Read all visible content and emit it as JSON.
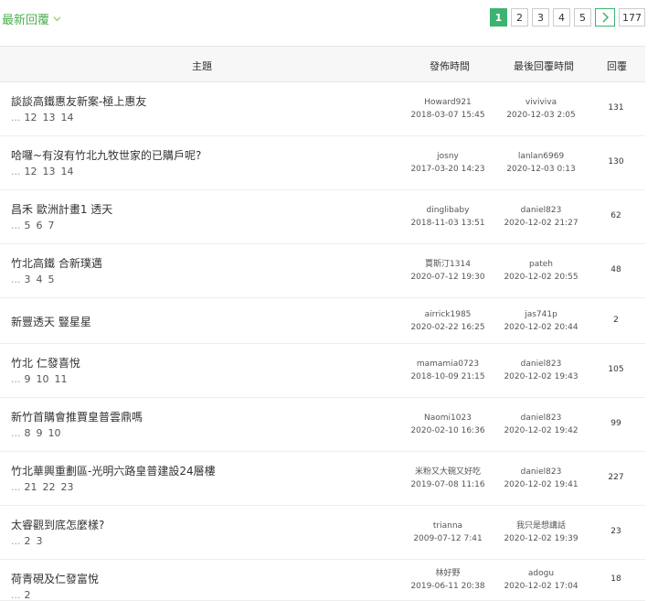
{
  "sort": {
    "label": "最新回覆"
  },
  "pager": {
    "pages": [
      "1",
      "2",
      "3",
      "4",
      "5"
    ],
    "last": "177",
    "active": "1"
  },
  "headers": {
    "topic": "主題",
    "posted": "發佈時間",
    "last_reply": "最後回覆時間",
    "replies": "回覆"
  },
  "rows": [
    {
      "title": "談談高鐵惠友新案-極上惠友",
      "pages": [
        "12",
        "13",
        "14"
      ],
      "author": "Howard921",
      "post_time": "2018-03-07 15:45",
      "last_user": "viviviva",
      "last_time": "2020-12-03 2:05",
      "replies": "131"
    },
    {
      "title": "哈囉~有沒有竹北九牧世家的已購戶呢?",
      "pages": [
        "12",
        "13",
        "14"
      ],
      "author": "josny",
      "post_time": "2017-03-20 14:23",
      "last_user": "lanlan6969",
      "last_time": "2020-12-03 0:13",
      "replies": "130"
    },
    {
      "title": "昌禾 歐洲計畫1 透天",
      "pages": [
        "5",
        "6",
        "7"
      ],
      "author": "dinglibaby",
      "post_time": "2018-11-03 13:51",
      "last_user": "daniel823",
      "last_time": "2020-12-02 21:27",
      "replies": "62"
    },
    {
      "title": "竹北高鐵 合新璞邁",
      "pages": [
        "3",
        "4",
        "5"
      ],
      "author": "賈斯汀1314",
      "post_time": "2020-07-12 19:30",
      "last_user": "pateh",
      "last_time": "2020-12-02 20:55",
      "replies": "48"
    },
    {
      "title": "新豐透天 豎星星",
      "pages": [],
      "author": "airrick1985",
      "post_time": "2020-02-22 16:25",
      "last_user": "jas741p",
      "last_time": "2020-12-02 20:44",
      "replies": "2"
    },
    {
      "title": "竹北 仁發喜悅",
      "pages": [
        "9",
        "10",
        "11"
      ],
      "author": "mamamia0723",
      "post_time": "2018-10-09 21:15",
      "last_user": "daniel823",
      "last_time": "2020-12-02 19:43",
      "replies": "105"
    },
    {
      "title": "新竹首購會推賈皇普雲鼎嗎",
      "pages": [
        "8",
        "9",
        "10"
      ],
      "author": "Naomi1023",
      "post_time": "2020-02-10 16:36",
      "last_user": "daniel823",
      "last_time": "2020-12-02 19:42",
      "replies": "99"
    },
    {
      "title": "竹北華興重劃區-光明六路皇普建設24層樓",
      "pages": [
        "21",
        "22",
        "23"
      ],
      "author": "米粉又大碗又好吃",
      "post_time": "2019-07-08 11:16",
      "last_user": "daniel823",
      "last_time": "2020-12-02 19:41",
      "replies": "227"
    },
    {
      "title": "太睿觀到底怎麼樣?",
      "pages": [
        "2",
        "3"
      ],
      "author": "trianna",
      "post_time": "2009-07-12 7:41",
      "last_user": "我只是想講話",
      "last_time": "2020-12-02 19:39",
      "replies": "23"
    },
    {
      "title": "荷青硯及仁發富悅",
      "pages": [
        "2"
      ],
      "author": "林好野",
      "post_time": "2019-06-11 20:38",
      "last_user": "adogu",
      "last_time": "2020-12-02 17:04",
      "replies": "18"
    }
  ],
  "colors": {
    "accent": "#3cb371",
    "sort_text": "#4caf50"
  },
  "icons": {
    "sort_chevron": "chevron-down-icon",
    "next": "chevron-right-icon"
  }
}
